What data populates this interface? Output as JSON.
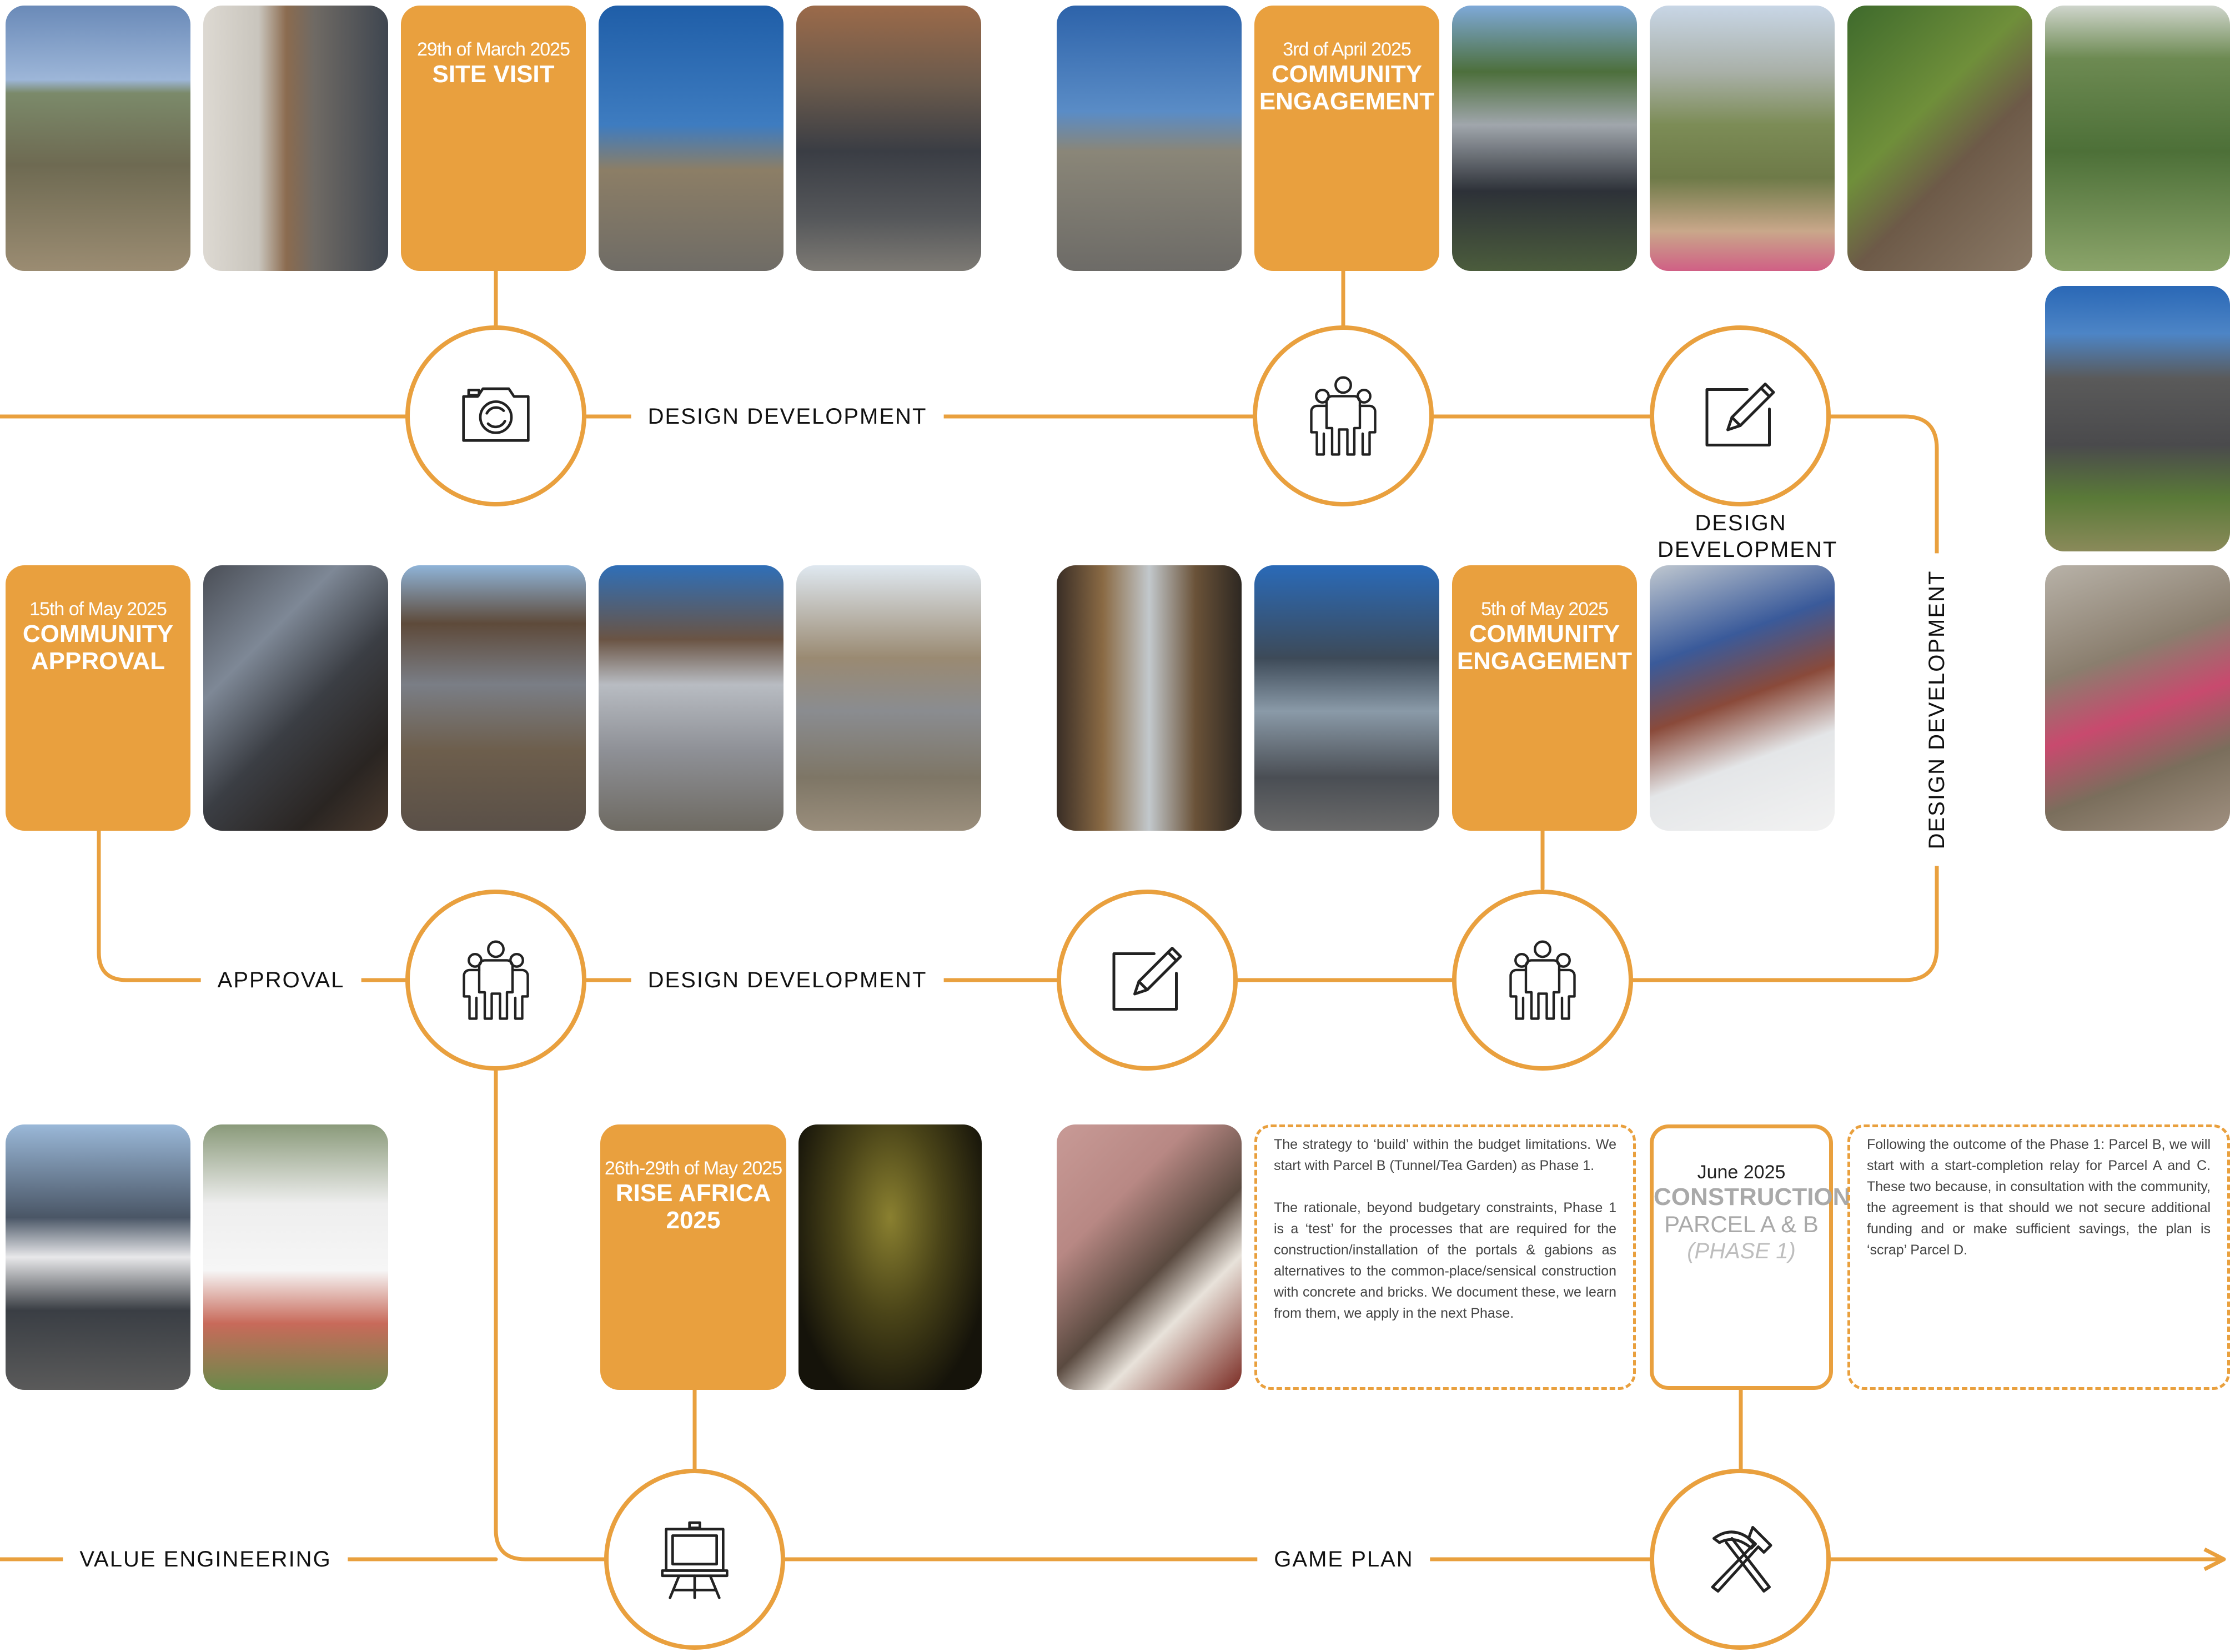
{
  "colors": {
    "accent": "#E9A03E",
    "line": "#E9A03E",
    "text": "#111111",
    "muted": "#A9A9A9"
  },
  "events": {
    "site_visit": {
      "date": "29th of March 2025",
      "title": "SITE VISIT"
    },
    "engagement_1": {
      "date": "3rd of April 2025",
      "title": "COMMUNITY ENGAGEMENT"
    },
    "approval": {
      "date": "15th of May 2025",
      "title": "COMMUNITY APPROVAL"
    },
    "engagement_2": {
      "date": "5th of May 2025",
      "title": "COMMUNITY ENGAGEMENT"
    },
    "rise_africa": {
      "date": "26th-29th of May 2025",
      "title": "RISE AFRICA 2025"
    },
    "construction": {
      "date": "June 2025",
      "title": "CONSTRUCTION",
      "subtitle": "PARCEL A & B",
      "phase": "(PHASE 1)"
    }
  },
  "line_labels": {
    "row1_design": "DESIGN DEVELOPMENT",
    "node_design": "DESIGN DEVELOPMENT",
    "vertical_design": "DESIGN DEVELOPMENT",
    "approval": "APPROVAL",
    "row2_design": "DESIGN DEVELOPMENT",
    "value_engineering": "VALUE ENGINEERING",
    "game_plan": "GAME PLAN"
  },
  "notes": {
    "strategy": "The strategy to ‘build’ within the budget limitations. We start with Parcel B (Tunnel/Tea Garden) as Phase 1.\n\nThe rationale, beyond budgetary constraints, Phase 1 is a ‘test’ for the processes that are required for the construction/installation of the portals & gabions as alternatives to the common-place/sensical construction with concrete and bricks. We document these, we learn from them, we apply in the next Phase.",
    "following": "Following the outcome of the Phase 1: Parcel B, we will start with a start-completion relay for Parcel A and C. These two because, in consultation with the community, the agreement is that should we not secure additional funding and or make sufficient savings, the plan is ‘scrap’ Parcel D."
  },
  "icons": {
    "site_visit": "camera-icon",
    "engagement_1": "people-icon",
    "design": "pen-on-paper-icon",
    "approval": "people-icon",
    "design_2": "pen-on-paper-icon",
    "engagement_2": "people-icon",
    "rise_africa": "easel-icon",
    "construction": "hammer-pickaxe-icon"
  }
}
